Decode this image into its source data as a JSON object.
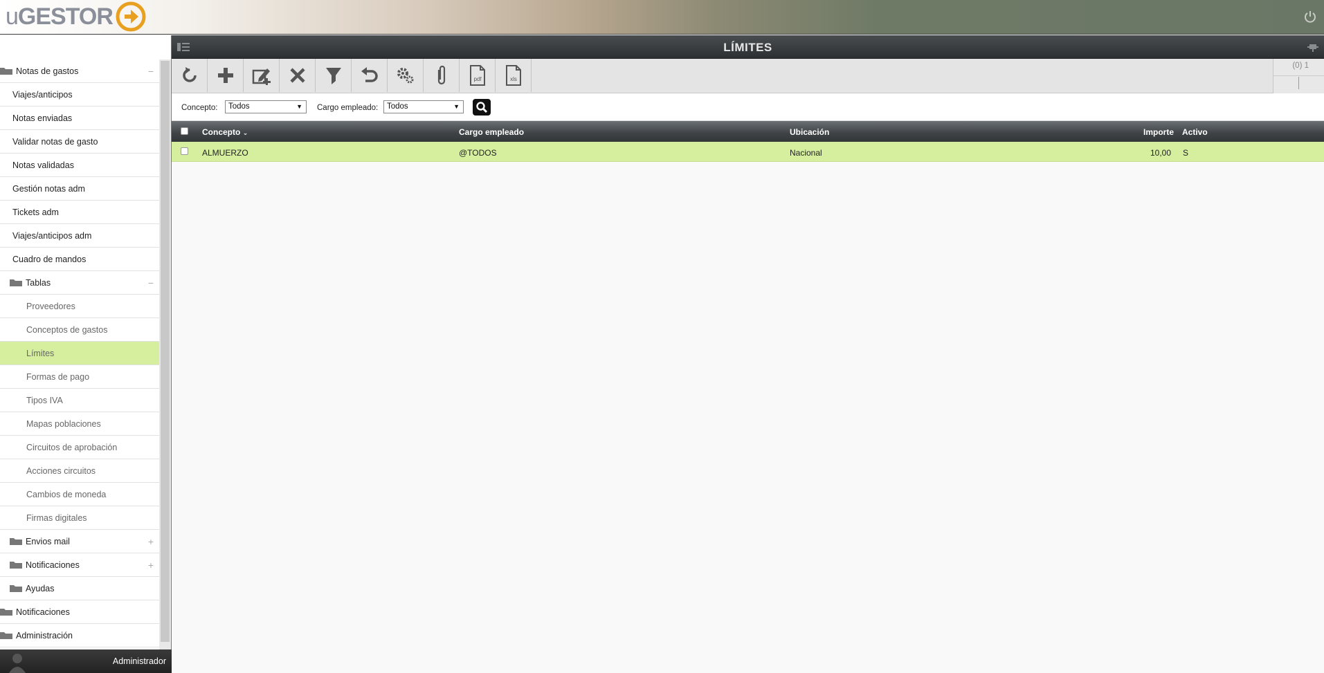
{
  "brand": {
    "logo_u": "u",
    "logo_rest": "GESTOR"
  },
  "page": {
    "title": "LÍMITES"
  },
  "sidebar": {
    "root_label": "Notas de gastos",
    "items": [
      "Viajes/anticipos",
      "Notas enviadas",
      "Validar notas de gasto",
      "Notas validadas",
      "Gestión notas adm",
      "Tickets adm",
      "Viajes/anticipos adm",
      "Cuadro de mandos"
    ],
    "tables_label": "Tablas",
    "table_items": [
      "Proveedores",
      "Conceptos de gastos",
      "Límites",
      "Formas de pago",
      "Tipos IVA",
      "Mapas poblaciones",
      "Circuitos de aprobación",
      "Acciones circuitos",
      "Cambios de moneda",
      "Firmas digitales"
    ],
    "active_item": "Límites",
    "sub_folders": [
      "Envios mail",
      "Notificaciones",
      "Ayudas"
    ],
    "root_folders": [
      "Notificaciones",
      "Administración"
    ],
    "collapse_symbol": "−",
    "expand_symbol": "+"
  },
  "user": {
    "name": "Administrador"
  },
  "toolbar": {
    "buttons": [
      "refresh-icon",
      "add-icon",
      "edit-icon",
      "delete-icon",
      "filter-icon",
      "undo-icon",
      "settings-icon",
      "attach-icon",
      "pdf-icon",
      "xls-icon"
    ],
    "pdf_label": "pdf",
    "xls_label": "xls"
  },
  "pager": {
    "text": "(0) 1"
  },
  "filters": {
    "concepto_label": "Concepto:",
    "concepto_value": "Todos",
    "cargo_label": "Cargo empleado:",
    "cargo_value": "Todos"
  },
  "grid": {
    "columns": [
      "Concepto",
      "Cargo empleado",
      "Ubicación",
      "Importe",
      "Activo"
    ],
    "rows": [
      {
        "concepto": "ALMUERZO",
        "cargo": "@TODOS",
        "ubicacion": "Nacional",
        "importe": "10,00",
        "activo": "S"
      }
    ]
  },
  "colors": {
    "accent_green": "#d6ef9f",
    "header_dark": "#2d3033",
    "brand_orange": "#e8a020"
  }
}
